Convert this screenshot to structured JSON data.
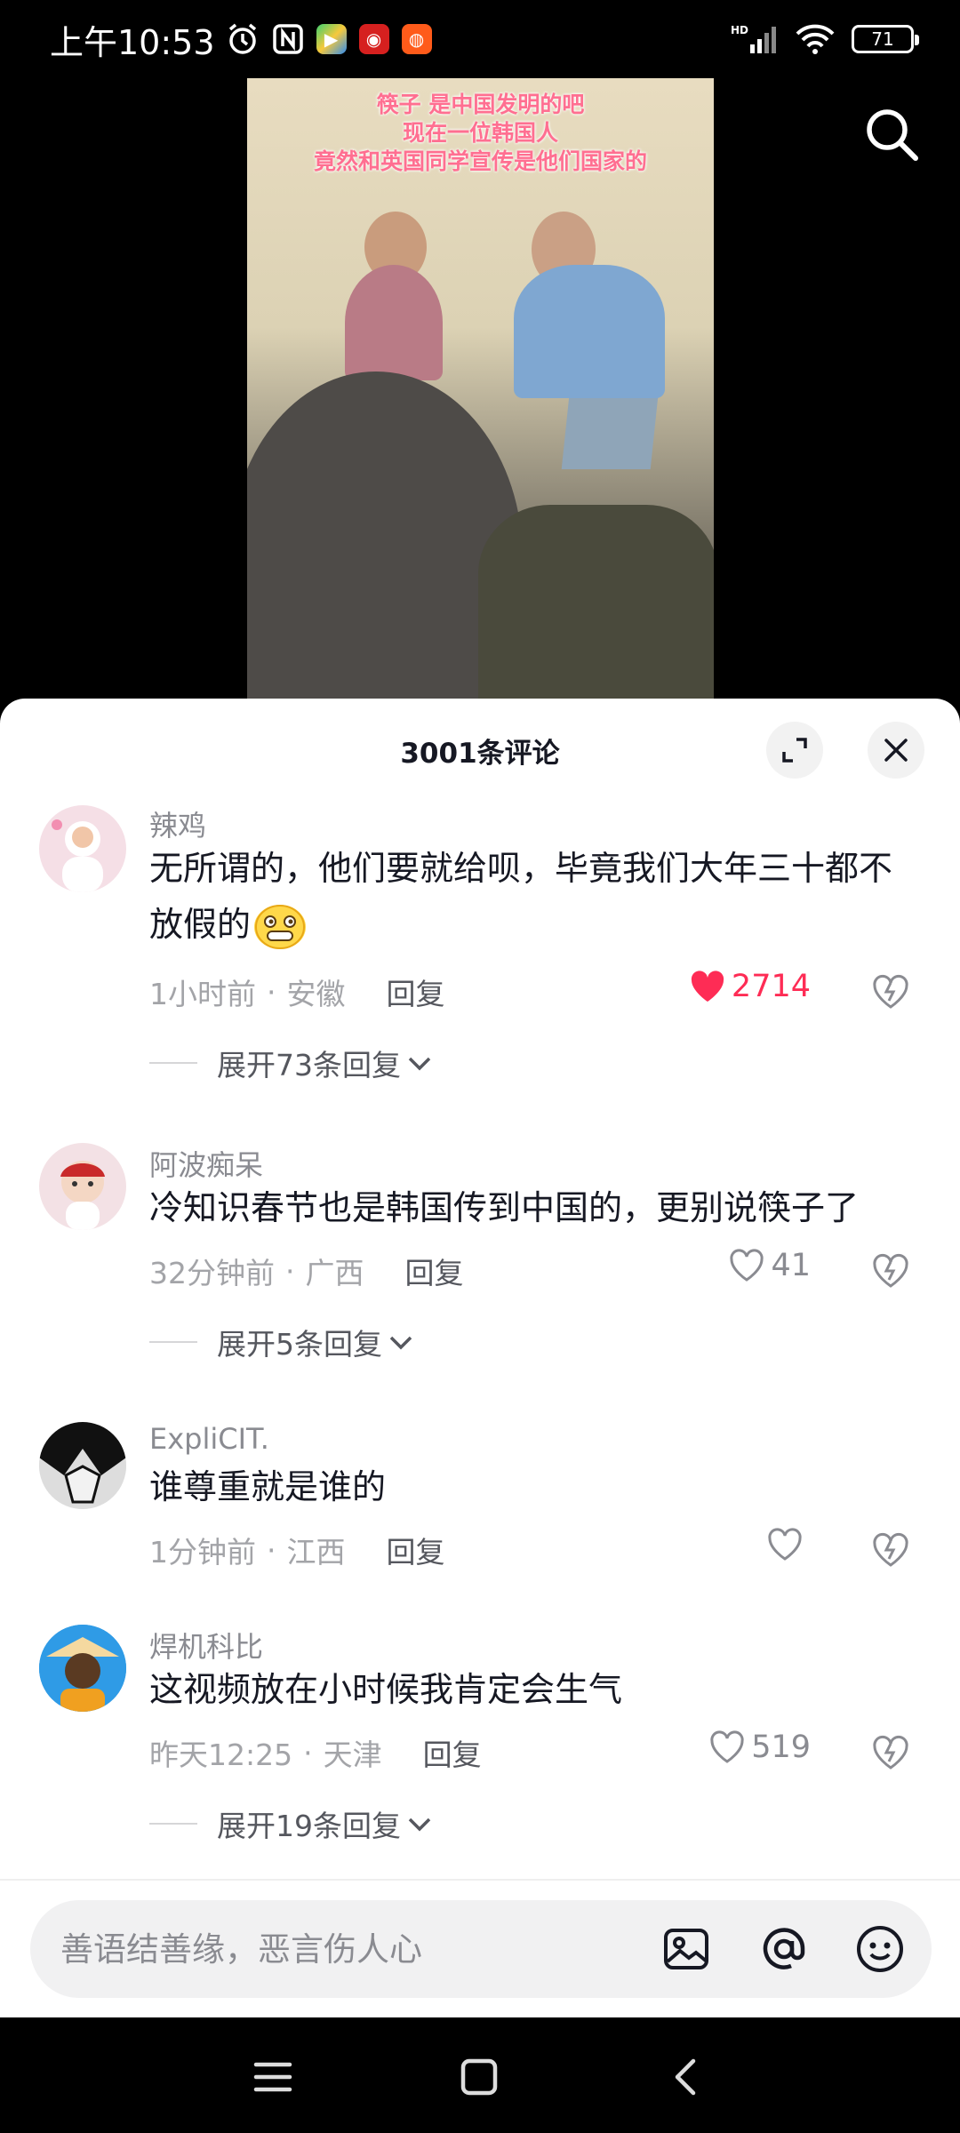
{
  "status_bar": {
    "time": "上午10:53",
    "battery": "71",
    "network_badge": "HD"
  },
  "video": {
    "caption_lines": [
      "筷子 是中国发明的吧",
      "现在一位韩国人",
      "竟然和英国同学宣传是他们国家的"
    ]
  },
  "comments_panel": {
    "title": "3001条评论",
    "comments": [
      {
        "username": "辣鸡",
        "text": "无所谓的，他们要就给呗，毕竟我们大年三十都不放假的",
        "time": "1小时前",
        "location": "安徽",
        "reply_label": "回复",
        "likes": "2714",
        "liked": true,
        "expand_label": "展开73条回复"
      },
      {
        "username": "阿波痴呆",
        "text": "冷知识春节也是韩国传到中国的，更别说筷子了",
        "time": "32分钟前",
        "location": "广西",
        "reply_label": "回复",
        "likes": "41",
        "liked": false,
        "expand_label": "展开5条回复"
      },
      {
        "username": "ExpliCIT.",
        "text": "谁尊重就是谁的",
        "time": "1分钟前",
        "location": "江西",
        "reply_label": "回复",
        "likes": "",
        "liked": false
      },
      {
        "username": "焊机科比",
        "text": "这视频放在小时候我肯定会生气",
        "time": "昨天12:25",
        "location": "天津",
        "reply_label": "回复",
        "likes": "519",
        "liked": false,
        "expand_label": "展开19条回复"
      }
    ]
  },
  "input": {
    "placeholder": "善语结善缘，恶言伤人心"
  },
  "colors": {
    "like_active": "#fe2c55",
    "caption": "#ff6f91"
  }
}
